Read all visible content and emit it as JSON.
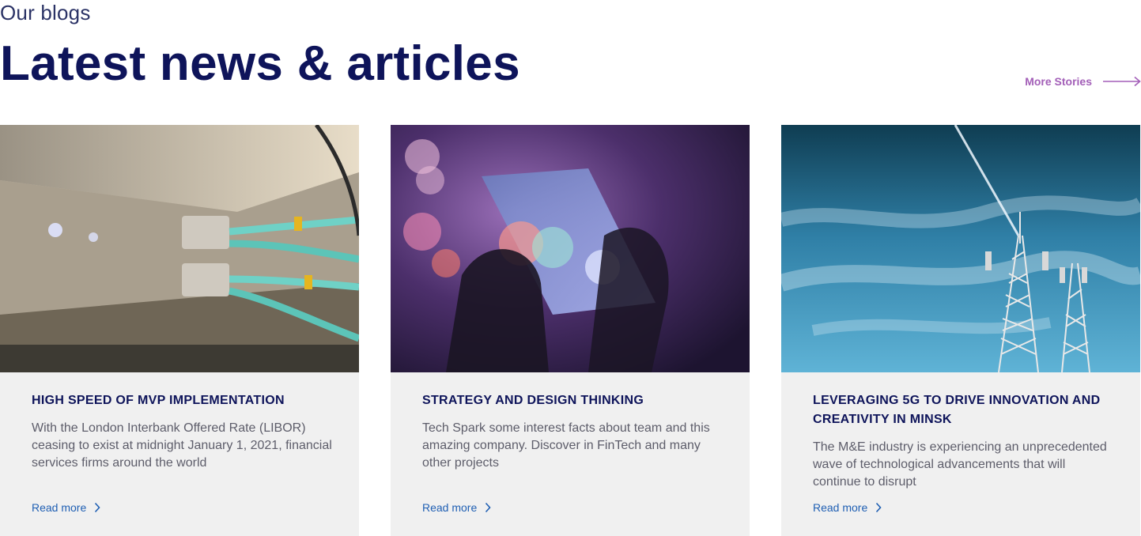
{
  "section": {
    "eyebrow": "Our blogs",
    "title": "Latest news & articles",
    "more_label": "More Stories"
  },
  "colors": {
    "heading": "#0e145a",
    "more_link": "#a35fb8",
    "read_more": "#1f5fb3",
    "card_bg": "#f0f0f0"
  },
  "cards": [
    {
      "title": "HIGH SPEED OF MVP IMPLEMENTATION",
      "text": "With the London Interbank Offered Rate (LIBOR) ceasing to exist at midnight January 1, 2021, financial services firms around the world",
      "link": "Read more",
      "image": "network-cables-photo"
    },
    {
      "title": "STRATEGY AND DESIGN THINKING",
      "text": "Tech Spark some interest facts about team and this amazing company. Discover in FinTech and many other projects",
      "link": "Read more",
      "image": "smartphone-bokeh-photo"
    },
    {
      "title": "LEVERAGING 5G TO DRIVE INNOVATION AND CREATIVITY IN MINSK",
      "text": "The M&E industry is experiencing an unprecedented wave of technological advancements that will continue to disrupt",
      "link": "Read more",
      "image": "cell-towers-sky-photo"
    }
  ]
}
